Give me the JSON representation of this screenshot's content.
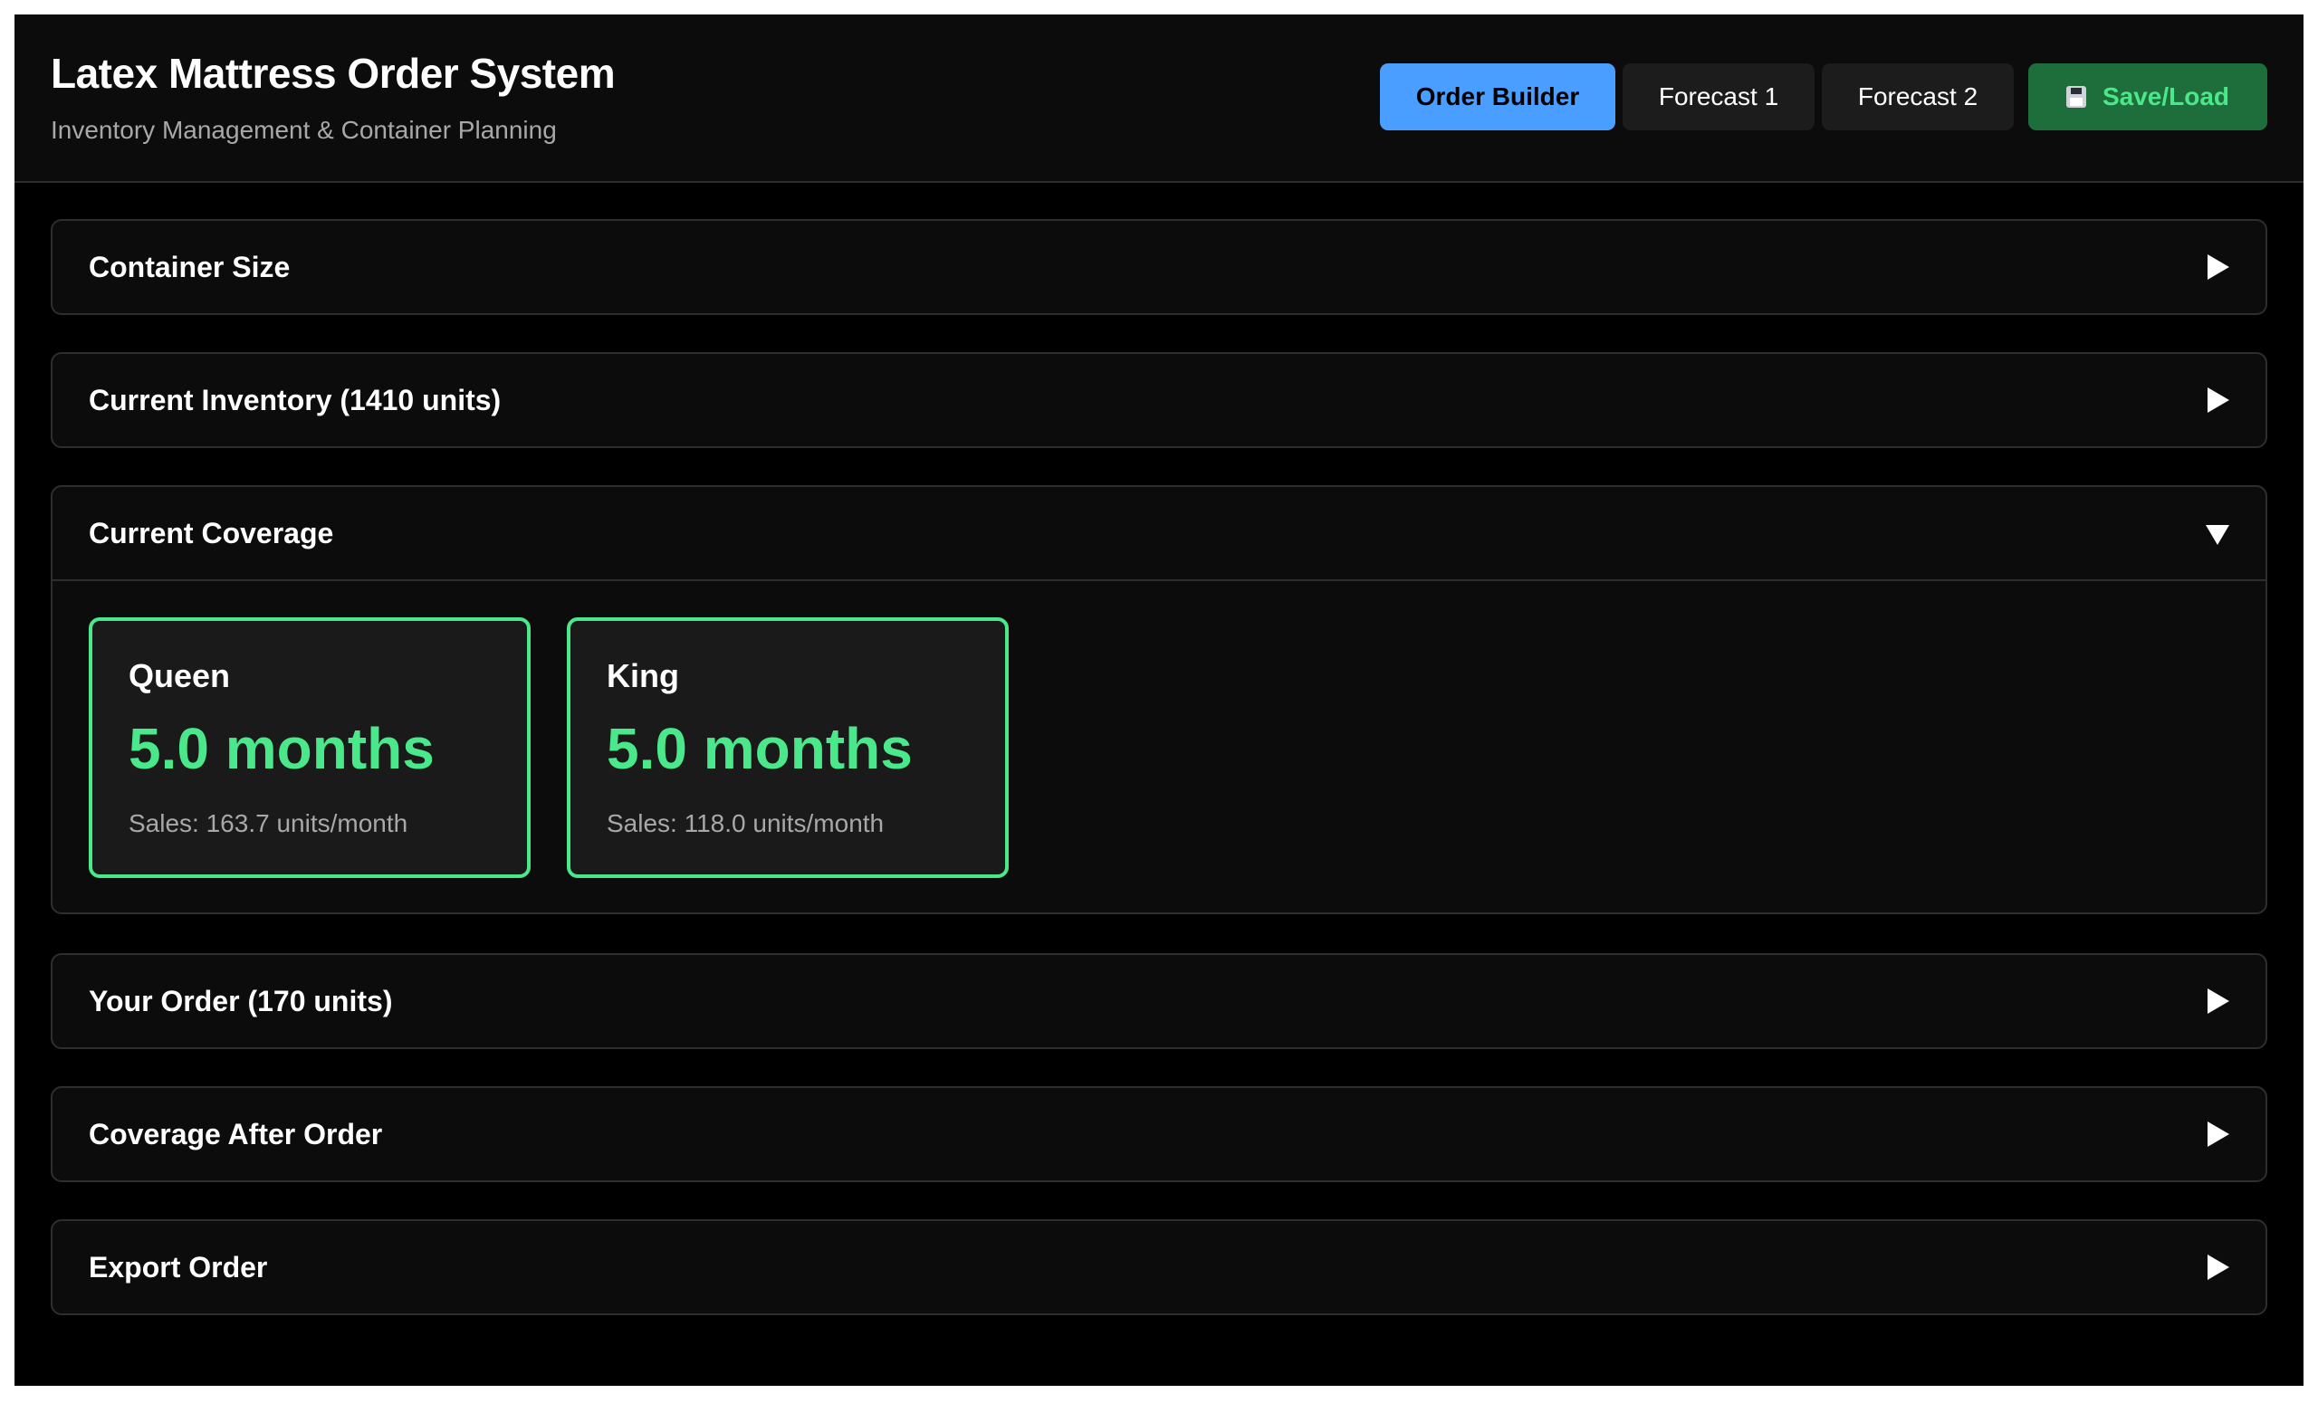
{
  "header": {
    "title": "Latex Mattress Order System",
    "subtitle": "Inventory Management & Container Planning"
  },
  "nav": {
    "order_builder": "Order Builder",
    "forecast_1": "Forecast 1",
    "forecast_2": "Forecast 2",
    "save_load": "Save/Load",
    "save_load_icon": "floppy-disk-icon"
  },
  "sections": {
    "container_size": {
      "title": "Container Size",
      "expanded": false
    },
    "current_inventory": {
      "title": "Current Inventory (1410 units)",
      "expanded": false
    },
    "current_coverage": {
      "title": "Current Coverage",
      "expanded": true,
      "cards": [
        {
          "name": "Queen",
          "value": "5.0 months",
          "sales": "Sales: 163.7 units/month"
        },
        {
          "name": "King",
          "value": "5.0 months",
          "sales": "Sales: 118.0 units/month"
        }
      ]
    },
    "your_order": {
      "title": "Your Order (170 units)",
      "expanded": false
    },
    "coverage_after_order": {
      "title": "Coverage After Order",
      "expanded": false
    },
    "export_order": {
      "title": "Export Order",
      "expanded": false
    }
  },
  "colors": {
    "accent_blue": "#4a9eff",
    "accent_green": "#4ae88a",
    "save_button_bg": "#1e6e3c",
    "background": "#000000",
    "panel": "#0c0c0c"
  }
}
